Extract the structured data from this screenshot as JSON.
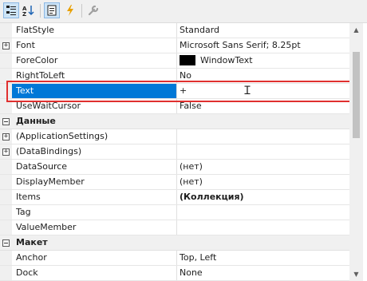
{
  "toolbar": {
    "buttons": [
      {
        "name": "categorized-icon",
        "glyph": "☷"
      },
      {
        "name": "alphabetical-icon",
        "glyph": "A↓"
      },
      {
        "name": "properties-icon",
        "glyph": "▤"
      },
      {
        "name": "events-icon",
        "glyph": "⚡"
      },
      {
        "name": "property-pages-icon",
        "glyph": "🔧"
      }
    ]
  },
  "grid": {
    "rows": [
      {
        "name": "FlatStyle",
        "value": "Standard"
      },
      {
        "name": "Font",
        "value": "Microsoft Sans Serif; 8.25pt",
        "expandable": true
      },
      {
        "name": "ForeColor",
        "value": "WindowText",
        "swatch": "#000000"
      },
      {
        "name": "RightToLeft",
        "value": "No"
      },
      {
        "name": "Text",
        "value": "+",
        "selected": true
      },
      {
        "name": "UseWaitCursor",
        "value": "False"
      },
      {
        "category": "Данные"
      },
      {
        "name": "(ApplicationSettings)",
        "value": "",
        "expandable": true
      },
      {
        "name": "(DataBindings)",
        "value": "",
        "expandable": true
      },
      {
        "name": "DataSource",
        "value": "(нет)"
      },
      {
        "name": "DisplayMember",
        "value": "(нет)"
      },
      {
        "name": "Items",
        "value": "(Коллекция)",
        "bold": true
      },
      {
        "name": "Tag",
        "value": ""
      },
      {
        "name": "ValueMember",
        "value": ""
      },
      {
        "category": "Макет"
      },
      {
        "name": "Anchor",
        "value": "Top, Left"
      },
      {
        "name": "Dock",
        "value": "None"
      }
    ]
  },
  "colors": {
    "selection": "#0078d7",
    "highlight_border": "#e0302f",
    "category_bg": "#f0f0f0"
  }
}
